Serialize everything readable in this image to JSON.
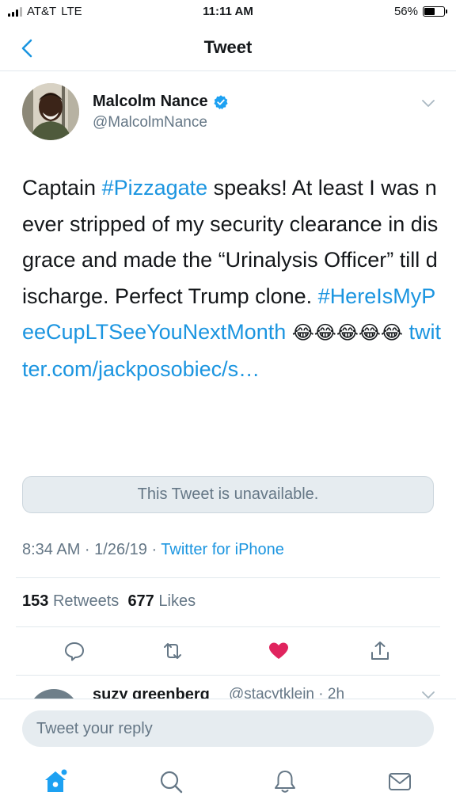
{
  "status_bar": {
    "carrier": "AT&T",
    "network": "LTE",
    "time": "11:11 AM",
    "battery_percent": "56%",
    "battery_level": 0.56
  },
  "nav": {
    "title": "Tweet",
    "back_icon": "chevron-left-icon"
  },
  "tweet": {
    "author_name": "Malcolm Nance",
    "handle": "@MalcolmNance",
    "verified": true,
    "text_segments": [
      {
        "text": "Captain ",
        "type": "plain"
      },
      {
        "text": "#Pizzagate",
        "type": "link"
      },
      {
        "text": " speaks! At least I was never stripped of my security clearance in disgrace and made the “Urinalysis Officer” till discharge. Perfect Trump clone. ",
        "type": "plain"
      },
      {
        "text": "#HereIsMyPeeCupLTSeeYouNextMonth",
        "type": "link"
      },
      {
        "text": " ",
        "type": "plain"
      },
      {
        "text": "😂😂😂😂😂",
        "type": "emoji"
      },
      {
        "text": " ",
        "type": "plain"
      },
      {
        "text": "twitter.com/jackposobiec/s…",
        "type": "link"
      }
    ],
    "quoted_unavailable": "This Tweet is unavailable.",
    "timestamp": "8:34 AM · 1/26/19 · ",
    "source": "Twitter for iPhone",
    "retweets_count": "153",
    "retweets_label": "Retweets",
    "likes_count": "677",
    "likes_label": "Likes"
  },
  "actions": [
    "reply-icon",
    "retweet-icon",
    "heart-icon",
    "share-icon"
  ],
  "colors": {
    "accent": "#1b95e0",
    "like": "#e0245e",
    "muted": "#657786",
    "text": "#14171a"
  },
  "reply_preview": {
    "name": "suzy greenberg",
    "handle": "@stacytklein · 2h"
  },
  "reply_bar": {
    "placeholder": "Tweet your reply"
  },
  "tab_bar": [
    "home-icon",
    "search-icon",
    "notifications-icon",
    "messages-icon"
  ]
}
